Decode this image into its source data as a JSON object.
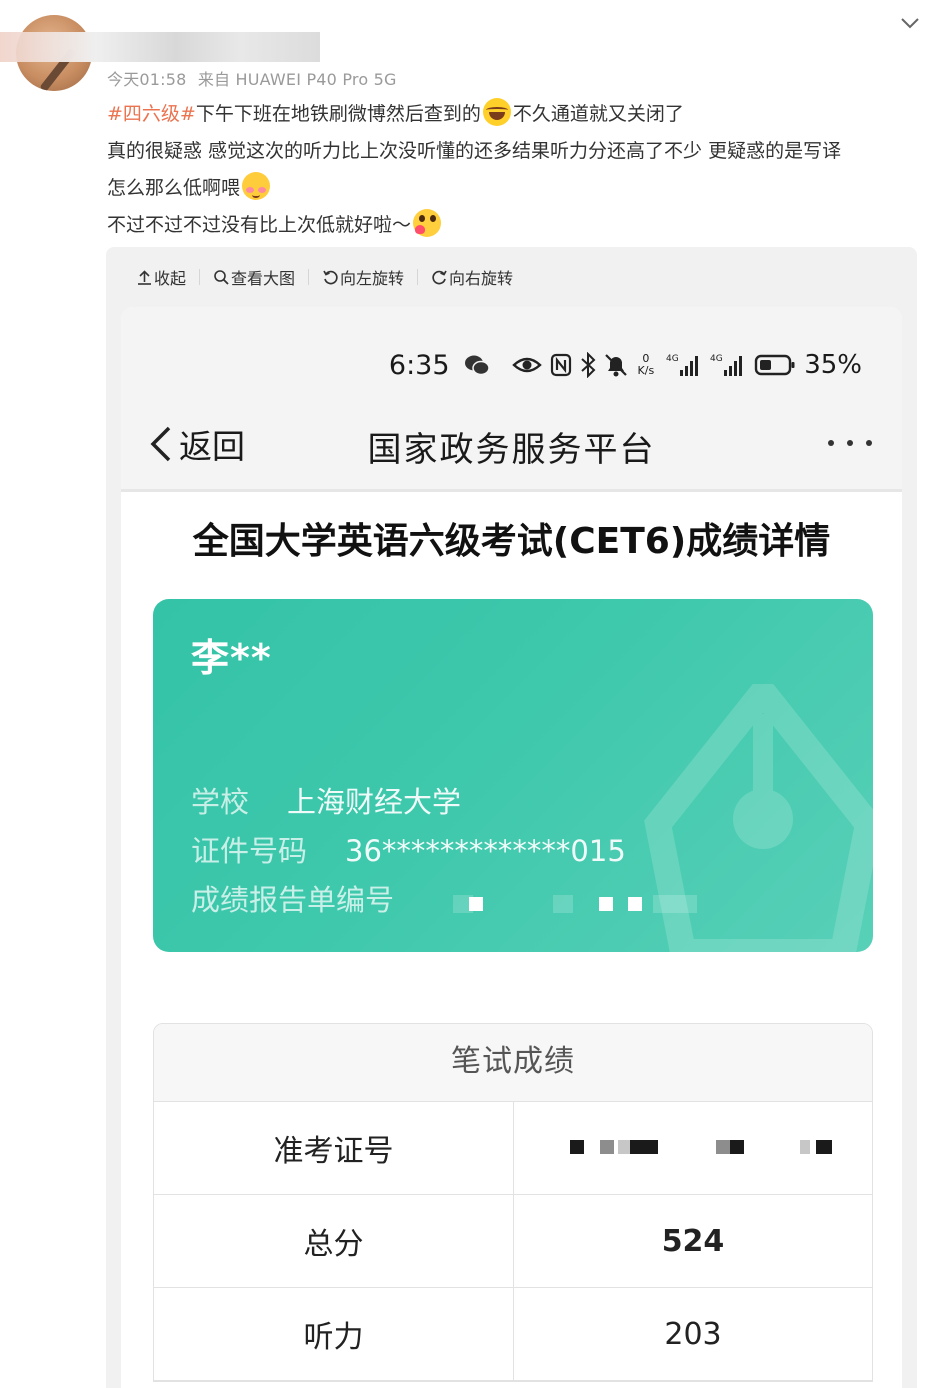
{
  "post": {
    "meta_time": "今天01:58",
    "meta_source": "来自 HUAWEI P40 Pro 5G",
    "hashtag": "#四六级#",
    "line1_a": "下午下班在地铁刷微博然后查到的",
    "line1_b": "不久通道就又关闭了",
    "line2": "真的很疑惑 感觉这次的听力比上次没听懂的还多结果听力分还高了不少 更疑惑的是写译",
    "line3": "怎么那么低啊喂",
    "line4": "不过不过不过没有比上次低就好啦～"
  },
  "viewer": {
    "toolbar": {
      "collapse": "收起",
      "view_large": "查看大图",
      "rotate_left": "向左旋转",
      "rotate_right": "向右旋转"
    }
  },
  "phone": {
    "status": {
      "time": "6:35",
      "net_speed_value": "0",
      "net_speed_unit": "K/s",
      "battery": "35%"
    },
    "app_bar": {
      "back": "返回",
      "title": "国家政务服务平台"
    },
    "page_title": "全国大学英语六级考试(CET6)成绩详情",
    "card": {
      "name": "李**",
      "school_label": "学校",
      "school_value": "上海财经大学",
      "id_label": "证件号码",
      "id_value": "36*************015",
      "report_label": "成绩报告单编号"
    },
    "scores": {
      "header": "笔试成绩",
      "rows": [
        {
          "label": "准考证号",
          "value": ""
        },
        {
          "label": "总分",
          "value": "524"
        },
        {
          "label": "听力",
          "value": "203"
        }
      ]
    }
  },
  "colors": {
    "hashtag": "#eb7350",
    "card_gradient_start": "#34c3a7",
    "card_gradient_end": "#58d0b8",
    "total_score": "#2aa86a"
  },
  "icons": [
    "chevron-down-icon",
    "collapse-icon",
    "magnifier-icon",
    "rotate-left-icon",
    "rotate-right-icon",
    "wechat-icon",
    "eye-icon",
    "nfc-icon",
    "bluetooth-icon",
    "mute-icon",
    "signal-icon",
    "battery-icon",
    "back-chevron-icon",
    "more-icon",
    "pen-nib-watermark-icon"
  ]
}
